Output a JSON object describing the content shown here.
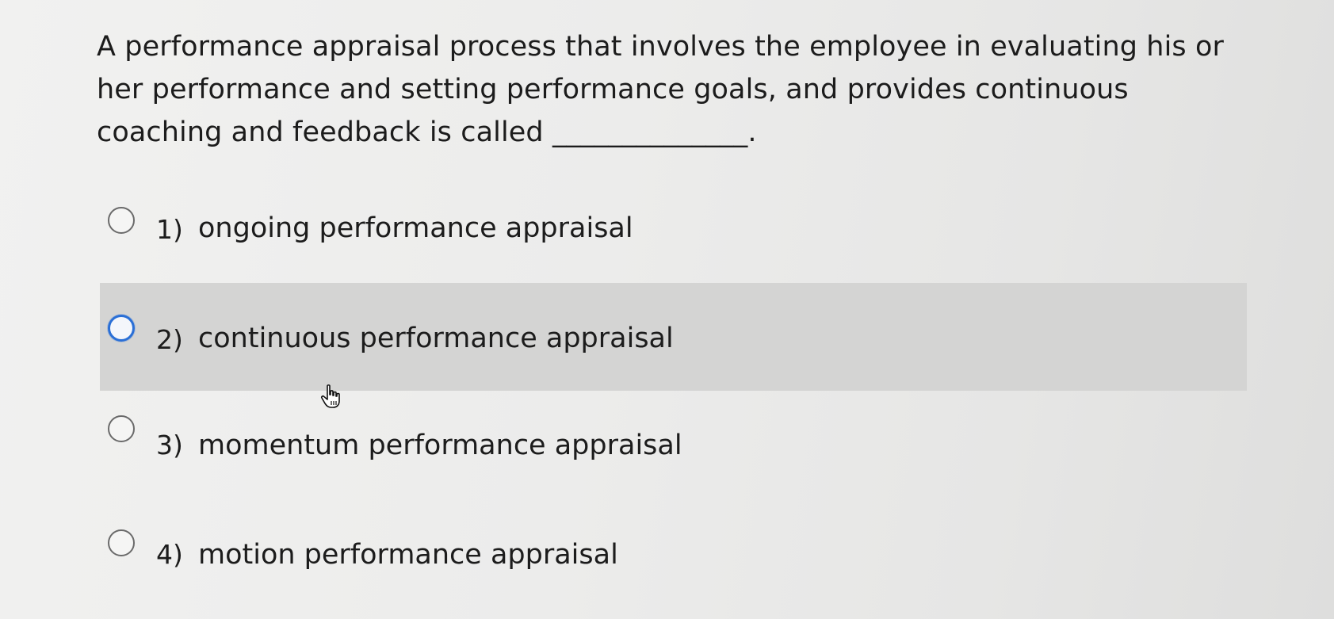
{
  "question": {
    "text": "A performance appraisal process that involves the employee in evaluating his or her performance and setting performance goals, and provides continuous coaching and feedback is called ______________."
  },
  "options": [
    {
      "number": "1)",
      "label": "ongoing performance appraisal",
      "selected": false,
      "hovered": false
    },
    {
      "number": "2)",
      "label": "continuous performance appraisal",
      "selected": false,
      "hovered": true
    },
    {
      "number": "3)",
      "label": "momentum performance appraisal",
      "selected": false,
      "hovered": false
    },
    {
      "number": "4)",
      "label": "motion performance appraisal",
      "selected": false,
      "hovered": false
    }
  ],
  "colors": {
    "hover_highlight": "#d4d4d3",
    "focus_ring": "#2a6fd6",
    "text": "#1c1c1c"
  },
  "icons": {
    "radio": "radio-button-icon",
    "cursor": "hand-pointer-icon"
  }
}
